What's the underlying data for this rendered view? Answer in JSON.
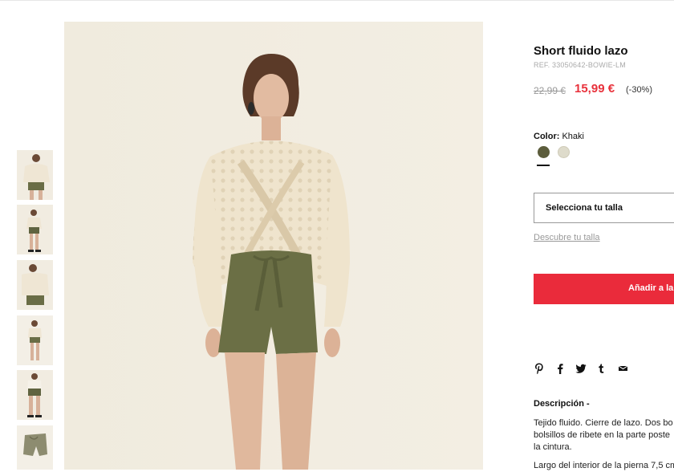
{
  "product": {
    "title": "Short fluido lazo",
    "reference": "REF. 33050642-BOWIE-LM",
    "price_original": "22,99 €",
    "price_sale": "15,99 €",
    "discount": "(-30%)"
  },
  "color": {
    "label": "Color:",
    "selected": "Khaki",
    "swatches": [
      {
        "name": "Khaki",
        "hex": "#5c5d3c"
      },
      {
        "name": "Crudo",
        "hex": "#dedbcb"
      }
    ]
  },
  "size": {
    "select_label": "Selecciona tu talla",
    "guide_link": "Descubre tu talla"
  },
  "cart": {
    "add_button": "Añadir a la"
  },
  "share_icons": [
    "pinterest-icon",
    "facebook-icon",
    "twitter-icon",
    "tumblr-icon",
    "email-icon"
  ],
  "description": {
    "title": "Descripción -",
    "lines": [
      "Tejido fluido. Cierre de lazo. Dos bo",
      "bolsillos de ribete en la parte poste",
      "la cintura."
    ],
    "extra_line": "Largo del interior de la pierna 7,5 cm"
  },
  "colors": {
    "accent": "#ea2b3b",
    "sale_price": "#e8323c",
    "image_background": "#f1ece0"
  }
}
